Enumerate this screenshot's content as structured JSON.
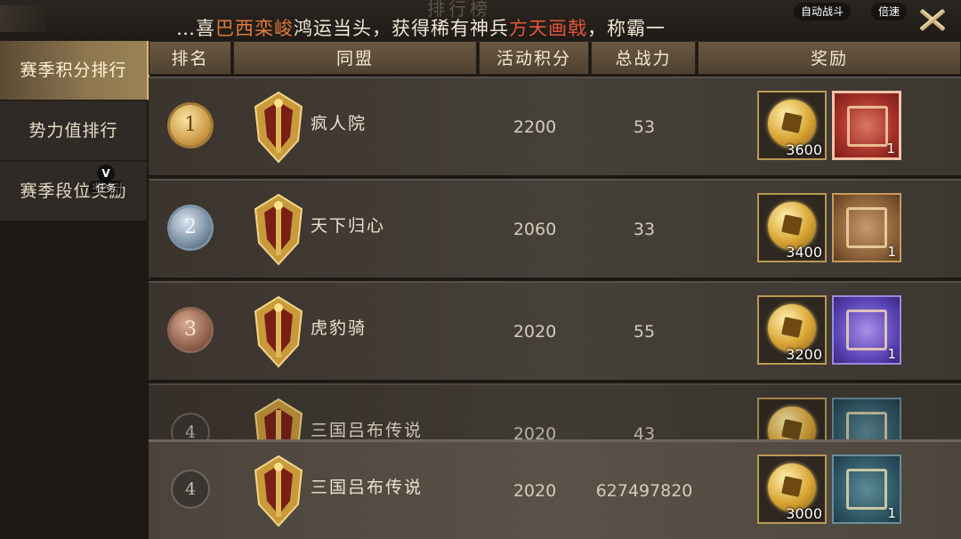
{
  "banner": {
    "title_ghost": "排行榜",
    "marquee_parts": [
      "…喜",
      "巴西栾峻",
      "鸿运当头，获得稀有神兵",
      "方天画戟",
      "，称霸一"
    ],
    "auto_battle": "自动战斗",
    "speed": "倍速"
  },
  "sidebar": {
    "tabs": [
      {
        "label": "赛季积分排行"
      },
      {
        "label": "势力值排行"
      },
      {
        "label": "赛季段位奖励"
      }
    ],
    "task": {
      "badge": "V",
      "label": "任务"
    }
  },
  "table": {
    "headers": [
      "排名",
      "同盟",
      "活动积分",
      "总战力",
      "奖励"
    ],
    "rows": [
      {
        "rank": "1",
        "guild": "疯人院",
        "points": "2200",
        "power": "53",
        "coin": "3600",
        "frame_qty": "1"
      },
      {
        "rank": "2",
        "guild": "天下归心",
        "points": "2060",
        "power": "33",
        "coin": "3400",
        "frame_qty": "1"
      },
      {
        "rank": "3",
        "guild": "虎豹骑",
        "points": "2020",
        "power": "55",
        "coin": "3200",
        "frame_qty": "1"
      },
      {
        "rank": "4",
        "guild": "三国吕布传说",
        "points": "2020",
        "power": "43",
        "coin": "",
        "frame_qty": ""
      }
    ],
    "my_row": {
      "rank": "4",
      "guild": "三国吕布传说",
      "points": "2020",
      "power": "627497820",
      "coin": "3000",
      "frame_qty": "1"
    }
  },
  "colors": {
    "highlight": "#e2553a",
    "gold": "#d6b670"
  },
  "icons": [
    "close-icon",
    "coin-icon",
    "frame-icon",
    "alliance-emblem-icon",
    "rank-medal-icon"
  ]
}
